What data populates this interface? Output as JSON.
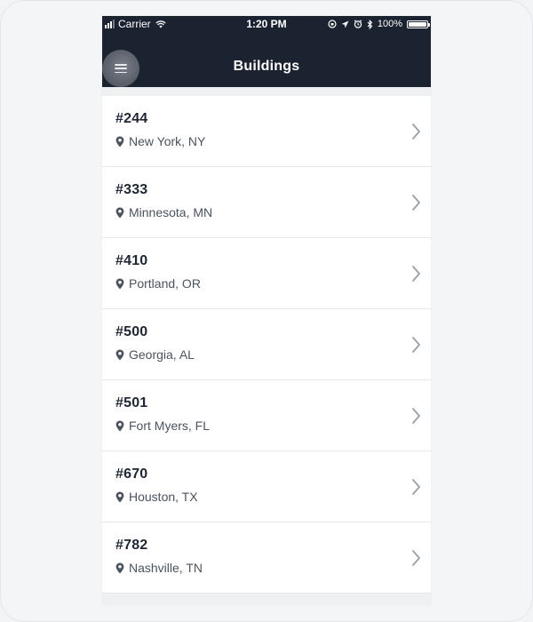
{
  "status_bar": {
    "carrier": "Carrier",
    "wifi_icon": "wifi-icon",
    "time": "1:20 PM",
    "icons": [
      "orientation-lock-icon",
      "location-arrow-icon",
      "alarm-icon",
      "bluetooth-icon"
    ],
    "battery_text": "100%",
    "battery_level": 1.0
  },
  "header": {
    "title": "Buildings",
    "menu_icon": "hamburger-menu-icon",
    "background": "#1b2331"
  },
  "buildings": [
    {
      "id": "#244",
      "location": "New York, NY"
    },
    {
      "id": "#333",
      "location": "Minnesota, MN"
    },
    {
      "id": "#410",
      "location": "Portland, OR"
    },
    {
      "id": "#500",
      "location": "Georgia, AL"
    },
    {
      "id": "#501",
      "location": "Fort Myers, FL"
    },
    {
      "id": "#670",
      "location": "Houston, TX"
    },
    {
      "id": "#782",
      "location": "Nashville, TN"
    }
  ],
  "colors": {
    "text_primary": "#1e2533",
    "text_secondary": "#4b5260",
    "chevron": "#9aa0aa"
  }
}
